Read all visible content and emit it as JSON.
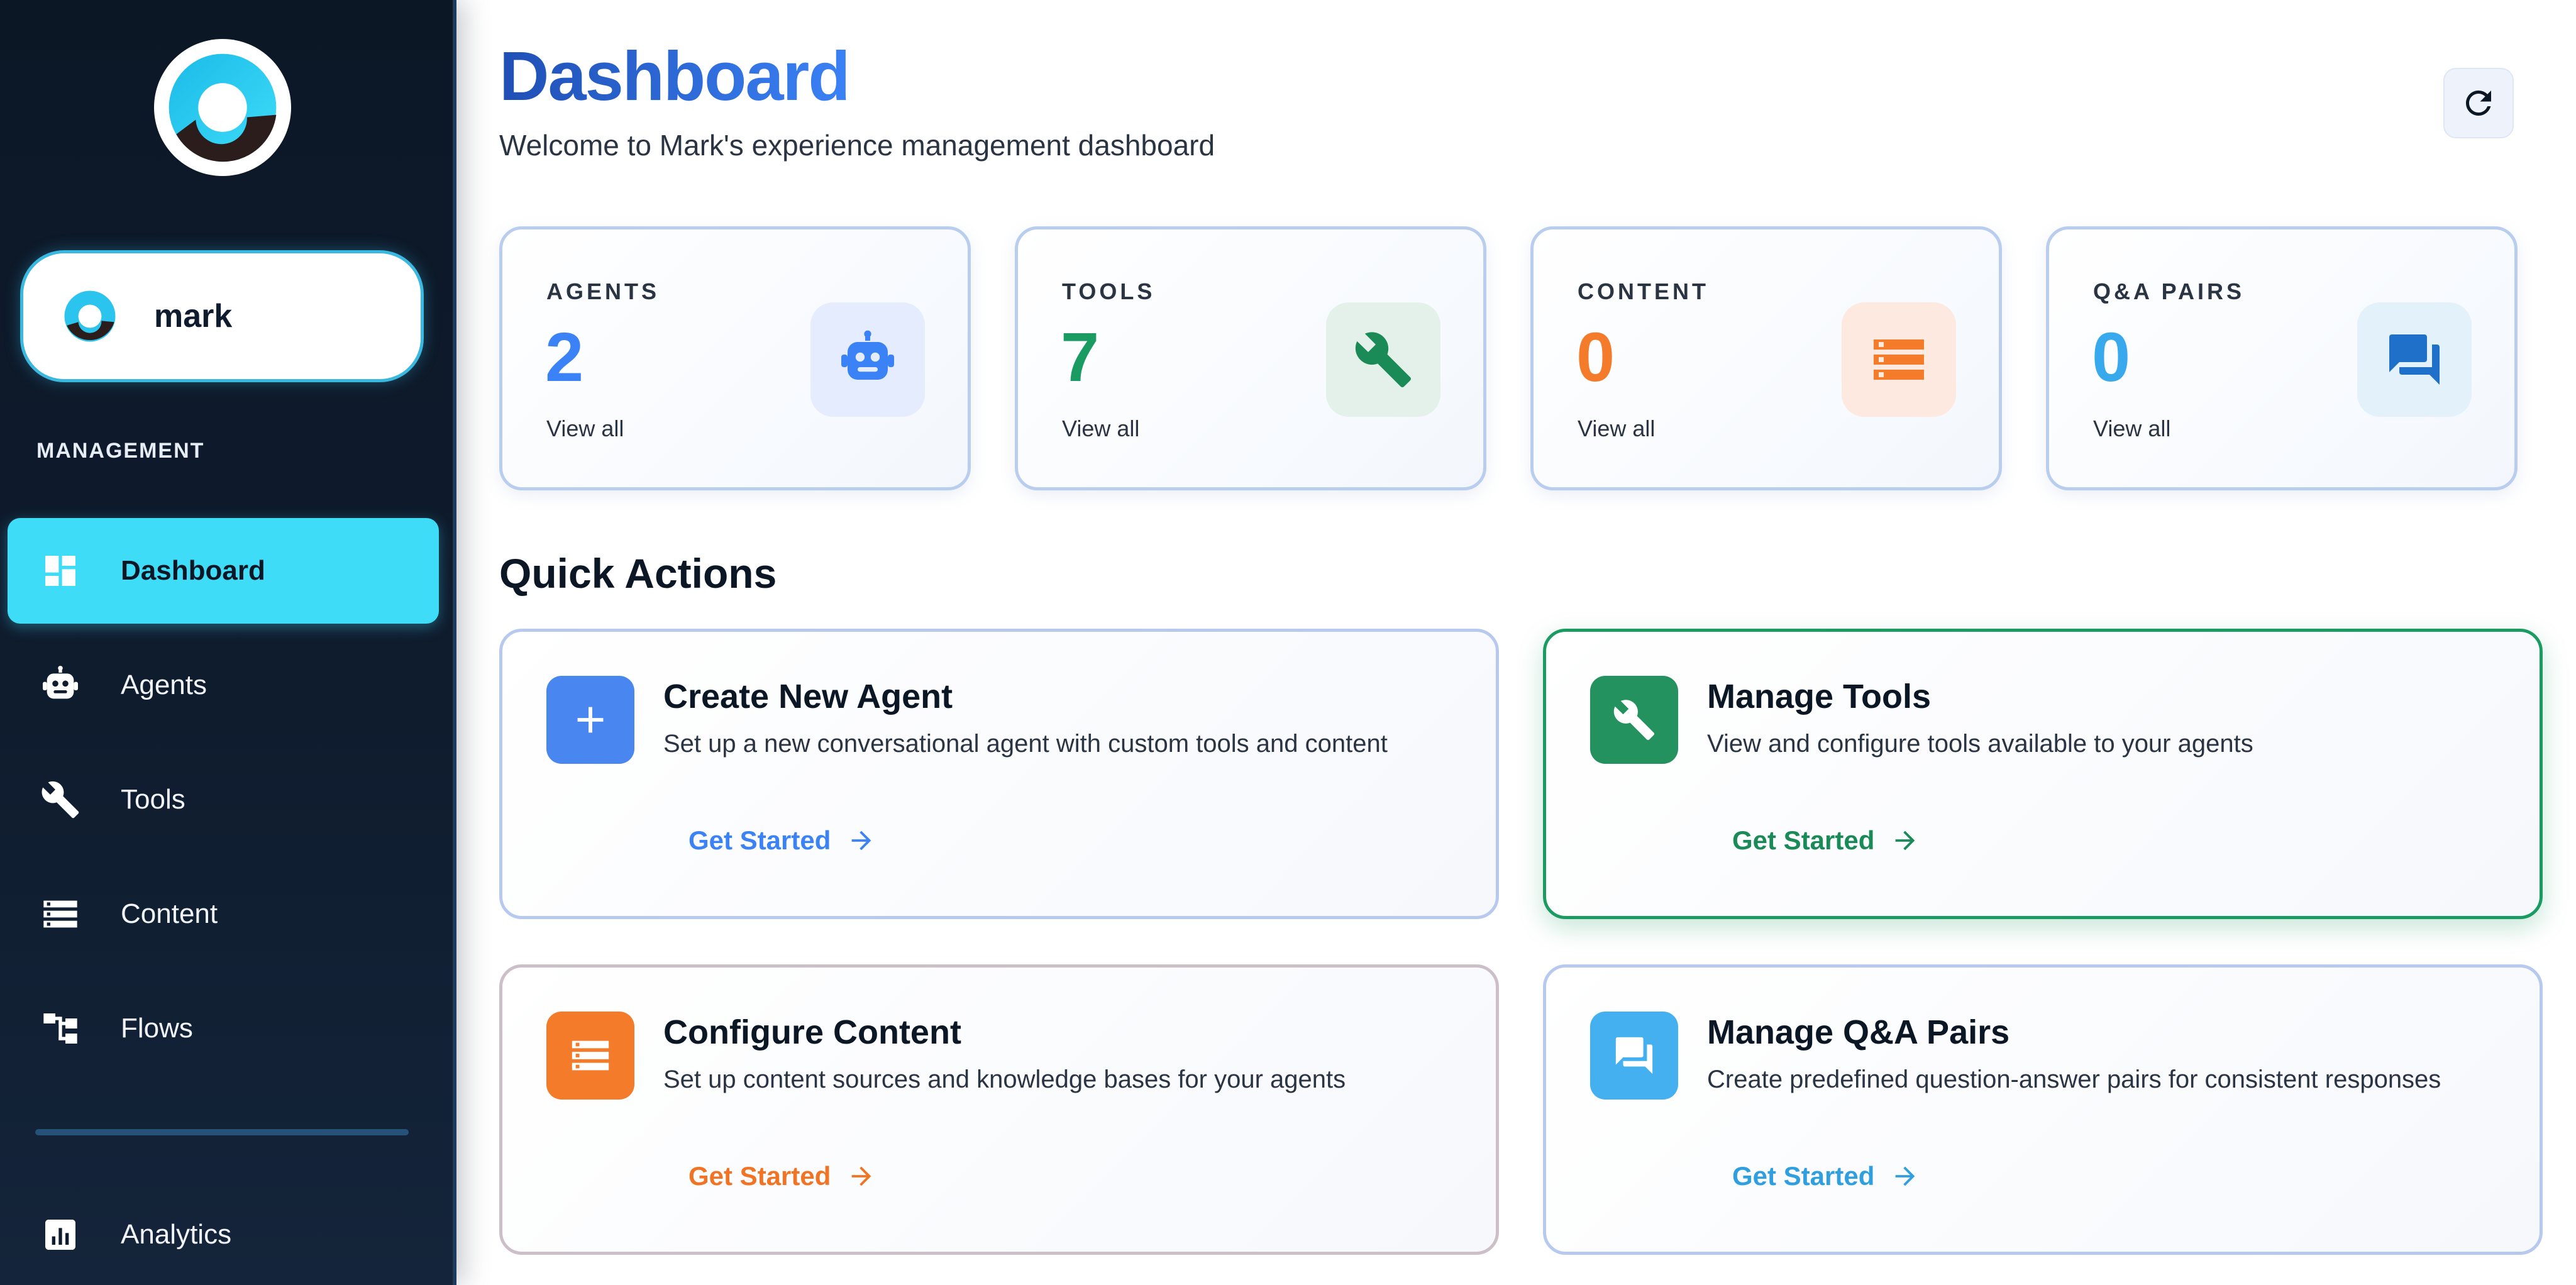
{
  "sidebar": {
    "user": {
      "name": "mark"
    },
    "section_label": "MANAGEMENT",
    "items": [
      {
        "label": "Dashboard",
        "icon": "dashboard-icon",
        "active": true
      },
      {
        "label": "Agents",
        "icon": "robot-icon"
      },
      {
        "label": "Tools",
        "icon": "wrench-icon"
      },
      {
        "label": "Content",
        "icon": "storage-icon"
      },
      {
        "label": "Flows",
        "icon": "flow-icon"
      },
      {
        "label": "Analytics",
        "icon": "analytics-icon"
      }
    ]
  },
  "header": {
    "title": "Dashboard",
    "subtitle": "Welcome to Mark's experience management dashboard",
    "refresh_icon": "refresh-icon"
  },
  "stats": [
    {
      "label": "AGENTS",
      "value": "2",
      "link": "View all",
      "color": "#3b82f6",
      "icon": "robot-icon"
    },
    {
      "label": "TOOLS",
      "value": "7",
      "link": "View all",
      "color": "#1a9b62",
      "icon": "wrench-icon"
    },
    {
      "label": "CONTENT",
      "value": "0",
      "link": "View all",
      "color": "#f47b2a",
      "icon": "storage-icon"
    },
    {
      "label": "Q&A PAIRS",
      "value": "0",
      "link": "View all",
      "color": "#38a9ec",
      "icon": "chat-icon"
    }
  ],
  "quick_actions": {
    "title": "Quick Actions",
    "items": [
      {
        "title": "Create New Agent",
        "description": "Set up a new conversational agent with custom tools and content",
        "link": "Get Started",
        "color": "#3b82f6",
        "icon": "plus-icon"
      },
      {
        "title": "Manage Tools",
        "description": "View and configure tools available to your agents",
        "link": "Get Started",
        "color": "#1a9b62",
        "icon": "wrench-icon"
      },
      {
        "title": "Configure Content",
        "description": "Set up content sources and knowledge bases for your agents",
        "link": "Get Started",
        "color": "#f47b2a",
        "icon": "storage-icon"
      },
      {
        "title": "Manage Q&A Pairs",
        "description": "Create predefined question-answer pairs for consistent responses",
        "link": "Get Started",
        "color": "#38a9ec",
        "icon": "chat-icon"
      }
    ]
  },
  "colors": {
    "sidebar_bg": "#0f1c2e",
    "active_nav": "#3fdcf8",
    "title_blue": "#1f4fb5"
  }
}
